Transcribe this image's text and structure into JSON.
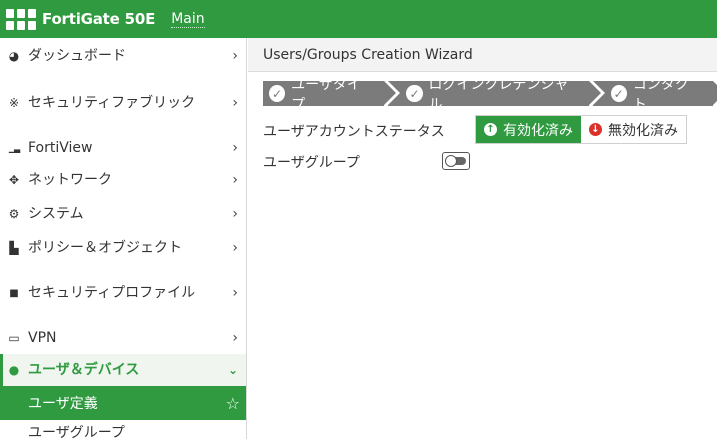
{
  "header": {
    "product": "FortiGate 50E",
    "vdom": "Main"
  },
  "sidebar": {
    "items": [
      {
        "icon": "dashboard-icon",
        "glyph": "◕",
        "label": "ダッシュボード"
      },
      {
        "icon": "security-fabric-icon",
        "glyph": "※",
        "label": "セキュリティファブリック"
      },
      {
        "icon": "fortiview-icon",
        "glyph": "▁▃",
        "label": "FortiView"
      },
      {
        "icon": "network-icon",
        "glyph": "✥",
        "label": "ネットワーク"
      },
      {
        "icon": "system-icon",
        "glyph": "⚙",
        "label": "システム"
      },
      {
        "icon": "policy-icon",
        "glyph": "▙",
        "label": "ポリシー＆オブジェクト"
      },
      {
        "icon": "lock-icon",
        "glyph": "🔒",
        "label": "セキュリティプロファイル"
      },
      {
        "icon": "vpn-icon",
        "glyph": "▭",
        "label": "VPN"
      },
      {
        "icon": "user-icon",
        "glyph": "●",
        "label": "ユーザ＆デバイス"
      }
    ],
    "sub_items": [
      {
        "label": "ユーザ定義"
      },
      {
        "label": "ユーザグループ"
      }
    ]
  },
  "main": {
    "title": "Users/Groups Creation Wizard",
    "steps": [
      {
        "label": "ユーザタイプ"
      },
      {
        "label": "ログインクレデンシャル"
      },
      {
        "label": "コンタクト"
      }
    ],
    "account_status_label": "ユーザアカウントステータス",
    "enable_label": "有効化済み",
    "disable_label": "無効化済み",
    "user_group_label": "ユーザグループ",
    "user_group_enabled": false
  },
  "colors": {
    "brand": "#2f9a3f",
    "step": "#7b7b7b",
    "disable": "#d9322b"
  }
}
